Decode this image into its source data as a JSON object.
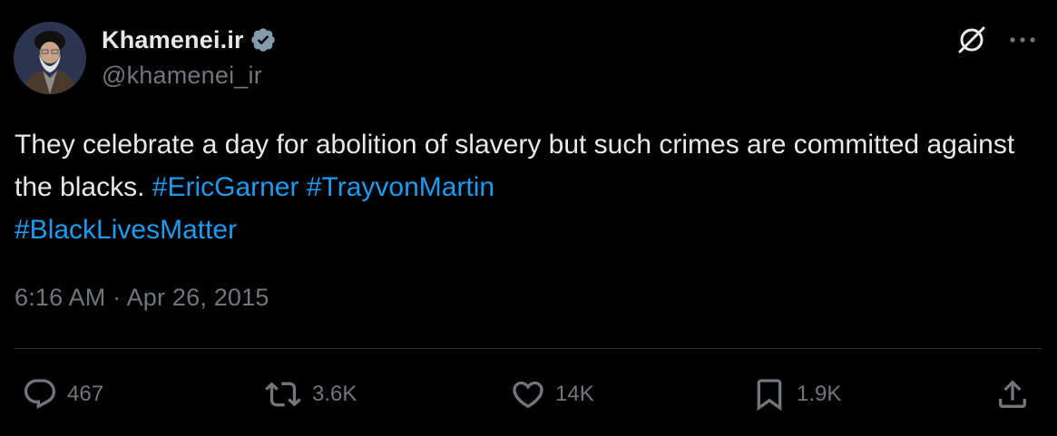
{
  "author": {
    "name": "Khamenei.ir",
    "handle": "@khamenei_ir",
    "verified": true
  },
  "tweet": {
    "text_plain": "They celebrate a day for abolition of slavery but such crimes are committed against the blacks.",
    "hashtags": [
      "#EricGarner",
      "#TrayvonMartin",
      "#BlackLivesMatter"
    ],
    "timestamp": "6:16 AM · Apr 26, 2015"
  },
  "actions": {
    "replies": "467",
    "reposts": "3.6K",
    "likes": "14K",
    "bookmarks": "1.9K"
  },
  "top_icons": [
    "grok-icon",
    "more-icon"
  ],
  "colors": {
    "background": "#000000",
    "text": "#e7e9ea",
    "muted": "#71767b",
    "hashtag": "#1d9bf0",
    "verified": "#829aab",
    "divider": "#2f3336"
  }
}
